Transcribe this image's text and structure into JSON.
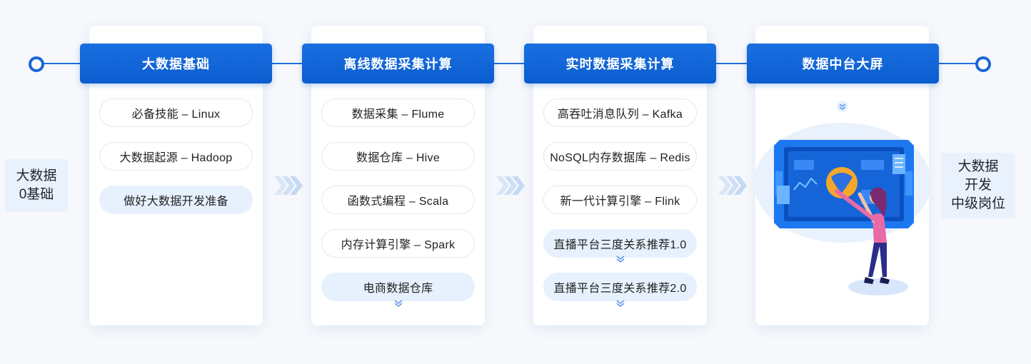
{
  "start_label": {
    "line1": "大数据",
    "line2": "0基础"
  },
  "end_label": {
    "line1": "大数据",
    "line2": "开发",
    "line3": "中级岗位"
  },
  "colors": {
    "accent": "#0b5dcf",
    "highlight_pill": "#e6f1fd",
    "arrow": "#cfe0f6"
  },
  "stages": [
    {
      "title": "大数据基础",
      "items": [
        "必备技能 – Linux",
        "大数据起源 – Hadoop",
        "做好大数据开发准备"
      ]
    },
    {
      "title": "离线数据采集计算",
      "items": [
        "数据采集 – Flume",
        "数据仓库 – Hive",
        "函数式编程 – Scala",
        "内存计算引擎 – Spark",
        "电商数据仓库"
      ]
    },
    {
      "title": "实时数据采集计算",
      "items": [
        "高吞吐消息队列 – Kafka",
        "NoSQL内存数据库 – Redis",
        "新一代计算引擎 – Flink",
        "直播平台三度关系推荐1.0",
        "直播平台三度关系推荐2.0"
      ]
    },
    {
      "title": "数据中台大屏",
      "illustration": "woman-touching-dashboard-screen-illustration"
    }
  ]
}
